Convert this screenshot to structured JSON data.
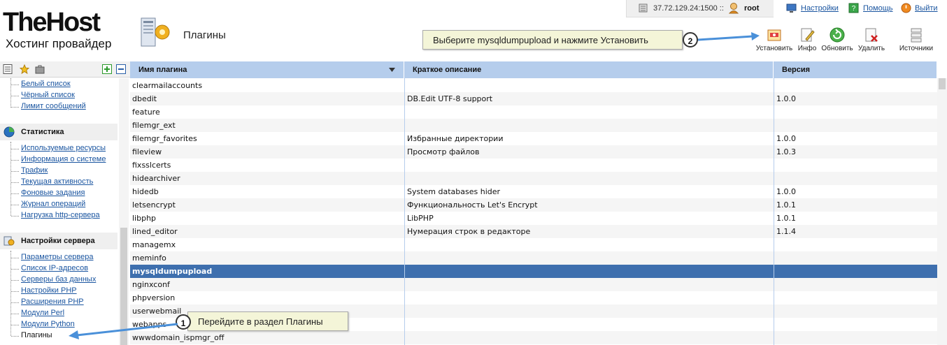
{
  "brand": {
    "logo": "TheHost",
    "subtitle": "Хостинг провайдер"
  },
  "page": {
    "title": "Плагины"
  },
  "topbar": {
    "server": "37.72.129.24:1500 ::",
    "user": "root",
    "links": [
      {
        "label": "Настройки",
        "icon": "monitor-icon"
      },
      {
        "label": "Помощь",
        "icon": "help-book-icon"
      },
      {
        "label": "Выйти",
        "icon": "power-icon"
      }
    ]
  },
  "toolbar": {
    "items": [
      {
        "label": "Установить",
        "icon": "install-icon"
      },
      {
        "label": "Инфо",
        "icon": "info-edit-icon"
      },
      {
        "label": "Обновить",
        "icon": "refresh-icon"
      },
      {
        "label": "Удалить",
        "icon": "delete-icon"
      },
      {
        "label": "Источники",
        "icon": "sources-icon"
      }
    ]
  },
  "callouts": {
    "step1": {
      "number": "1",
      "text": "Перейдите в раздел Плагины"
    },
    "step2": {
      "number": "2",
      "text": "Выберите mysqldumpupload и нажмите Установить"
    }
  },
  "sidebar": {
    "mail_items": [
      "Белый список",
      "Чёрный список",
      "Лимит сообщений"
    ],
    "stats": {
      "title": "Статистика",
      "items": [
        "Используемые ресурсы",
        "Информация о системе",
        "Трафик",
        "Текущая активность",
        "Фоновые задания",
        "Журнал операций",
        "Нагрузка http-сервера"
      ]
    },
    "server": {
      "title": "Настройки сервера",
      "items": [
        "Параметры сервера",
        "Список IP-адресов",
        "Серверы баз данных",
        "Настройки PHP",
        "Расширения PHP",
        "Модули Perl",
        "Модули Python",
        "Плагины"
      ]
    }
  },
  "table": {
    "columns": [
      "Имя плагина",
      "Краткое описание",
      "Версия"
    ],
    "rows": [
      {
        "name": "clearmailaccounts",
        "desc": "",
        "ver": ""
      },
      {
        "name": "dbedit",
        "desc": "DB.Edit UTF-8 support",
        "ver": "1.0.0"
      },
      {
        "name": "feature",
        "desc": "",
        "ver": ""
      },
      {
        "name": "filemgr_ext",
        "desc": "",
        "ver": ""
      },
      {
        "name": "filemgr_favorites",
        "desc": "Избранные директории",
        "ver": "1.0.0"
      },
      {
        "name": "fileview",
        "desc": "Просмотр файлов",
        "ver": "1.0.3"
      },
      {
        "name": "fixsslcerts",
        "desc": "",
        "ver": ""
      },
      {
        "name": "hidearchiver",
        "desc": "",
        "ver": ""
      },
      {
        "name": "hidedb",
        "desc": "System databases hider",
        "ver": "1.0.0"
      },
      {
        "name": "letsencrypt",
        "desc": "Функциональность Let's Encrypt",
        "ver": "1.0.1"
      },
      {
        "name": "libphp",
        "desc": "LibPHP",
        "ver": "1.0.1"
      },
      {
        "name": "lined_editor",
        "desc": "Нумерация строк в редакторе",
        "ver": "1.1.4"
      },
      {
        "name": "managemx",
        "desc": "",
        "ver": ""
      },
      {
        "name": "meminfo",
        "desc": "",
        "ver": ""
      },
      {
        "name": "mysqldumpupload",
        "desc": "",
        "ver": ""
      },
      {
        "name": "nginxconf",
        "desc": "",
        "ver": ""
      },
      {
        "name": "phpversion",
        "desc": "",
        "ver": ""
      },
      {
        "name": "userwebmail",
        "desc": "",
        "ver": ""
      },
      {
        "name": "webapps",
        "desc": "",
        "ver": ""
      },
      {
        "name": "wwwdomain_ispmgr_off",
        "desc": "",
        "ver": ""
      }
    ],
    "selected_index": 14
  },
  "colors": {
    "header": "#b5cdec",
    "selected": "#3e6fae",
    "link": "#1a55a0",
    "callout": "#f4f5d8",
    "arrow": "#4a90d9"
  }
}
